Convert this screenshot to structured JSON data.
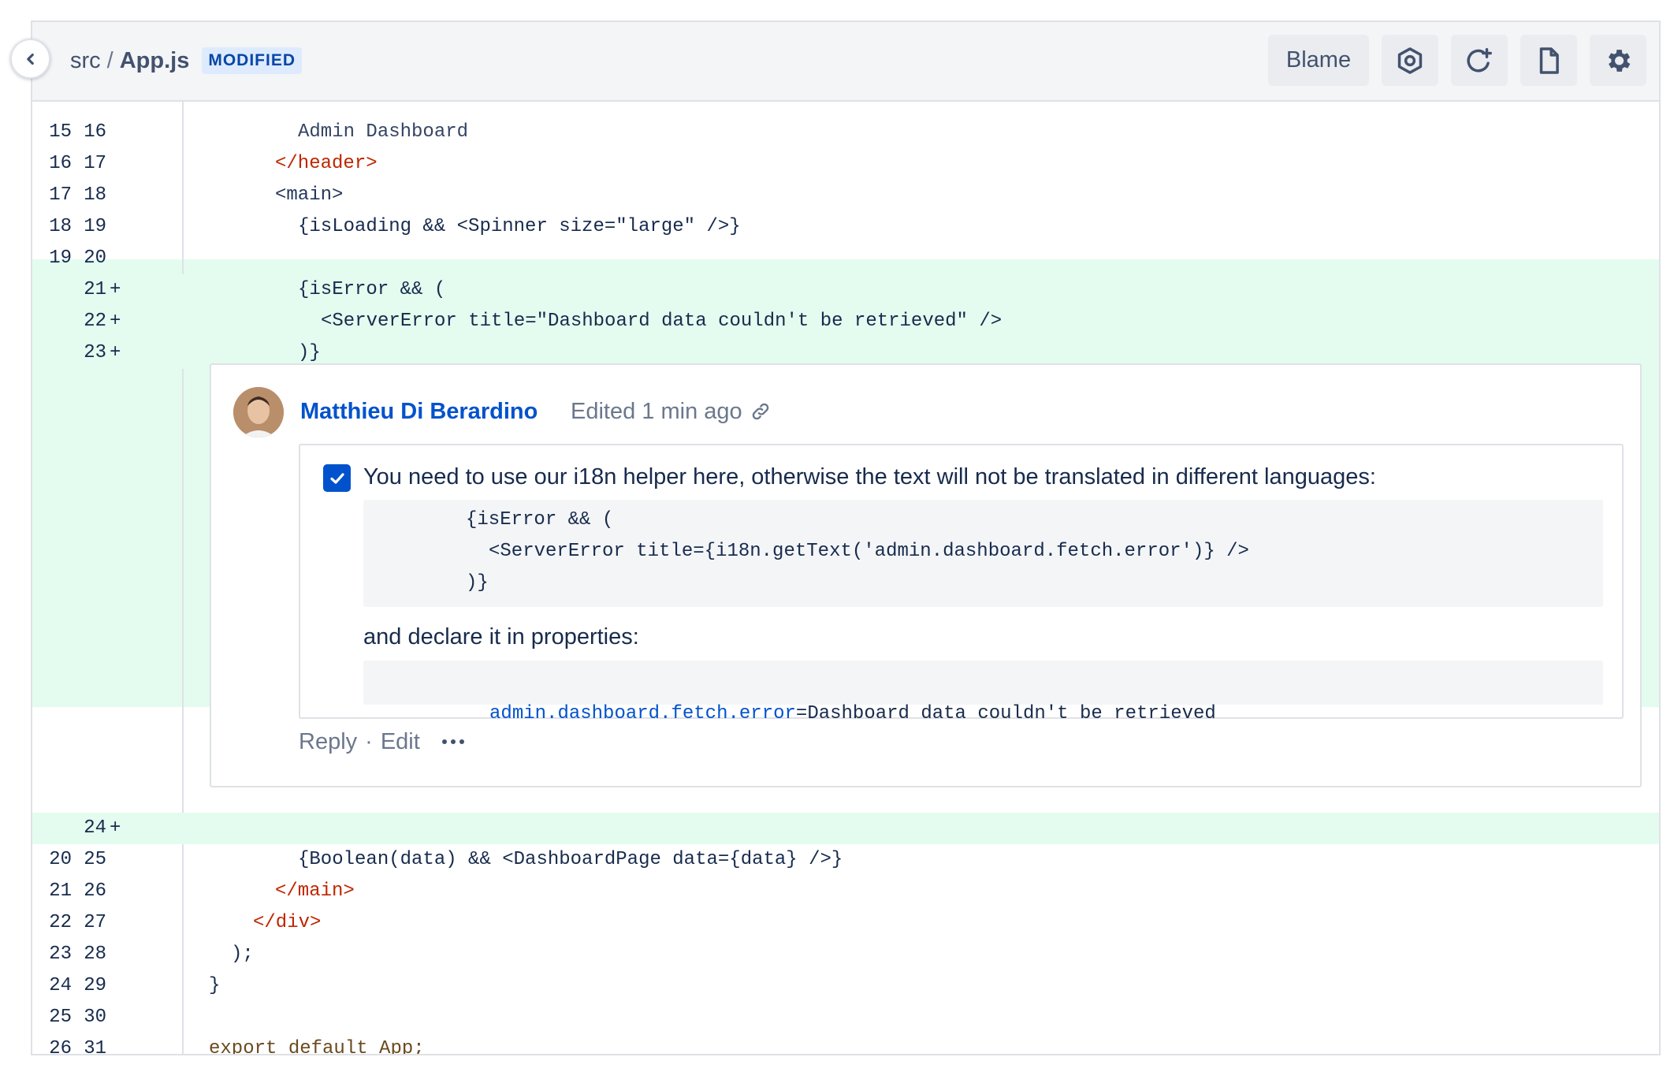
{
  "header": {
    "path_dir": "src",
    "path_sep": "/",
    "file_name": "App.js",
    "status_badge": "MODIFIED",
    "toolbar": {
      "blame_label": "Blame",
      "buttons": [
        "hexagon-icon",
        "refresh-add-icon",
        "file-icon",
        "gear-icon"
      ]
    }
  },
  "diff": {
    "lines_before": [
      {
        "old": "15",
        "new": "16",
        "code": "Admin Dashboard"
      },
      {
        "old": "16",
        "new": "17",
        "code": "</header>"
      },
      {
        "old": "17",
        "new": "18",
        "code": "<main>"
      },
      {
        "old": "18",
        "new": "19",
        "code": "{isLoading && <Spinner size=\"large\" />}"
      },
      {
        "old": "19",
        "new": "20",
        "code": ""
      }
    ],
    "added_lines": [
      {
        "new": "21",
        "sign": "+",
        "code": "{isError && ("
      },
      {
        "new": "22",
        "sign": "+",
        "code": "<ServerError title=\"Dashboard data couldn't be retrieved\" />"
      },
      {
        "new": "23",
        "sign": "+",
        "code": ")}"
      },
      {
        "new": "24",
        "sign": "+",
        "code": ""
      }
    ],
    "lines_after": [
      {
        "old": "20",
        "new": "25",
        "code": "{Boolean(data) && <DashboardPage data={data} />}"
      },
      {
        "old": "21",
        "new": "26",
        "code": "</main>"
      },
      {
        "old": "22",
        "new": "27",
        "code": "</div>"
      },
      {
        "old": "23",
        "new": "28",
        "code": ");"
      },
      {
        "old": "24",
        "new": "29",
        "code": "}"
      },
      {
        "old": "25",
        "new": "30",
        "code": ""
      },
      {
        "old": "26",
        "new": "31",
        "code": "export default App;"
      }
    ]
  },
  "comment": {
    "author": "Matthieu Di Berardino",
    "edited": "Edited 1 min ago",
    "resolved_checked": true,
    "text_intro": "You need to use our i18n helper here, otherwise the text will not be translated in different languages:",
    "code_lines": [
      "{isError && (",
      "<ServerError title={i18n.getText('admin.dashboard.fetch.error')} />",
      ")}"
    ],
    "text_properties": "and declare it in properties:",
    "property_key": "admin.dashboard.fetch.error",
    "property_eq": "=",
    "property_value": "Dashboard data couldn't be retrieved",
    "actions": {
      "reply": "Reply",
      "separator": "·",
      "edit": "Edit"
    }
  }
}
